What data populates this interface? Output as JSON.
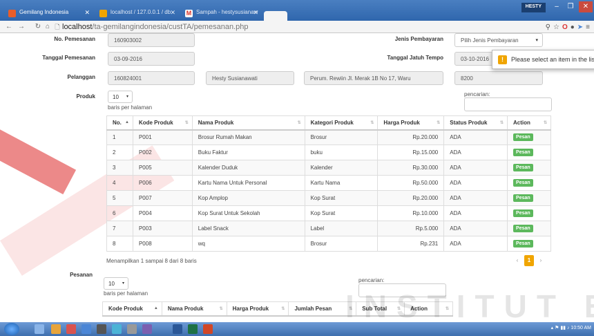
{
  "browser": {
    "tabs": [
      {
        "label": "Gemilang Indonesia",
        "active": false,
        "color": "#e85d2a"
      },
      {
        "label": "localhost / 127.0.0.1 / db",
        "active": false,
        "color": "#f0a500"
      },
      {
        "label": "Sampah - hestysusianaw",
        "active": false,
        "color": "#d93025"
      },
      {
        "label": "",
        "active": true,
        "color": "#f4f4f4"
      }
    ],
    "user": "HESTY",
    "url_host": "localhost",
    "url_path": "/ta-gemilangindonesia/custTA/pemesanan.php"
  },
  "form": {
    "no_pemesanan_label": "No. Pemesanan",
    "no_pemesanan": "160903002",
    "tanggal_pemesanan_label": "Tanggal Pemesanan",
    "tanggal_pemesanan": "03-09-2016",
    "pelanggan_label": "Pelanggan",
    "pelanggan_id": "160824001",
    "pelanggan_nama": "Hesty Susianawati",
    "pelanggan_alamat": "Perum. Rewiin Jl. Merak 1B No 17, Waru",
    "pelanggan_kode": "8200",
    "jenis_pembayaran_label": "Jenis Pembayaran",
    "jenis_pembayaran": "Pilih Jenis Pembayaran",
    "jatuh_tempo_label": "Tanggal Jatuh Tempo",
    "jatuh_tempo": "03-10-2016",
    "validation_msg": "Please select an item in the list."
  },
  "produk": {
    "label": "Produk",
    "length": "10",
    "per_page": "baris per halaman",
    "search_label": "pencarian:",
    "columns": [
      "No.",
      "Kode Produk",
      "Nama Produk",
      "Kategori Produk",
      "Harga Produk",
      "Status Produk",
      "Action"
    ],
    "rows": [
      {
        "no": "1",
        "kode": "P001",
        "nama": "Brosur Rumah Makan",
        "kategori": "Brosur",
        "harga": "Rp.20.000",
        "status": "ADA",
        "action": "Pesan"
      },
      {
        "no": "2",
        "kode": "P002",
        "nama": "Buku Faktur",
        "kategori": "buku",
        "harga": "Rp.15.000",
        "status": "ADA",
        "action": "Pesan"
      },
      {
        "no": "3",
        "kode": "P005",
        "nama": "Kalender Duduk",
        "kategori": "Kalender",
        "harga": "Rp.30.000",
        "status": "ADA",
        "action": "Pesan"
      },
      {
        "no": "4",
        "kode": "P006",
        "nama": "Kartu Nama Untuk Personal",
        "kategori": "Kartu Nama",
        "harga": "Rp.50.000",
        "status": "ADA",
        "action": "Pesan"
      },
      {
        "no": "5",
        "kode": "P007",
        "nama": "Kop Amplop",
        "kategori": "Kop Surat",
        "harga": "Rp.20.000",
        "status": "ADA",
        "action": "Pesan"
      },
      {
        "no": "6",
        "kode": "P004",
        "nama": "Kop Surat Untuk Sekolah",
        "kategori": "Kop Surat",
        "harga": "Rp.10.000",
        "status": "ADA",
        "action": "Pesan"
      },
      {
        "no": "7",
        "kode": "P003",
        "nama": "Label Snack",
        "kategori": "Label",
        "harga": "Rp.5.000",
        "status": "ADA",
        "action": "Pesan"
      },
      {
        "no": "8",
        "kode": "P008",
        "nama": "wq",
        "kategori": "Brosur",
        "harga": "Rp.231",
        "status": "ADA",
        "action": "Pesan"
      }
    ],
    "info": "Menampilkan 1 sampai 8 dari 8 baris",
    "pager": {
      "prev": "‹",
      "current": "1",
      "next": "›"
    }
  },
  "pesanan": {
    "label": "Pesanan",
    "length": "10",
    "per_page": "baris per halaman",
    "search_label": "pencarian:",
    "columns": [
      "Kode Produk",
      "Nama Produk",
      "Harga Produk",
      "Jumlah Pesan",
      "Sub Total",
      "Action"
    ]
  },
  "watermark": "INSTITUT BISNIS",
  "taskbar": {
    "clock": "10:50 AM"
  }
}
